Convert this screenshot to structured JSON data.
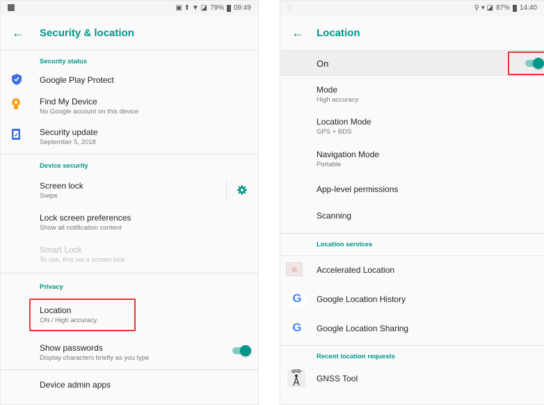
{
  "left": {
    "status": {
      "battery": "79%",
      "time": "09:49"
    },
    "title": "Security & location",
    "sections": {
      "security_status": "Security status",
      "device_security": "Device security",
      "privacy": "Privacy"
    },
    "items": {
      "play_protect": {
        "title": "Google Play Protect"
      },
      "find_device": {
        "title": "Find My Device",
        "sub": "No Google account on this device"
      },
      "security_update": {
        "title": "Security update",
        "sub": "September 5, 2018"
      },
      "screen_lock": {
        "title": "Screen lock",
        "sub": "Swipe"
      },
      "lock_prefs": {
        "title": "Lock screen preferences",
        "sub": "Show all notification content"
      },
      "smart_lock": {
        "title": "Smart Lock",
        "sub": "To use, first set a screen lock"
      },
      "location": {
        "title": "Location",
        "sub": "ON / High accuracy"
      },
      "show_passwords": {
        "title": "Show passwords",
        "sub": "Display characters briefly as you type",
        "enabled": true
      },
      "device_admin": {
        "title": "Device admin apps"
      }
    }
  },
  "right": {
    "status": {
      "battery": "87%",
      "time": "14:40"
    },
    "title": "Location",
    "master": {
      "label": "On",
      "enabled": true
    },
    "items": {
      "mode": {
        "title": "Mode",
        "sub": "High accuracy"
      },
      "location_mode": {
        "title": "Location Mode",
        "sub": "GPS + BDS"
      },
      "navigation_mode": {
        "title": "Navigation Mode",
        "sub": "Portable"
      },
      "app_permissions": {
        "title": "App-level permissions"
      },
      "scanning": {
        "title": "Scanning"
      }
    },
    "sections": {
      "location_services": "Location services",
      "recent_requests": "Recent location requests"
    },
    "services": [
      {
        "title": "Accelerated Location"
      },
      {
        "title": "Google Location History"
      },
      {
        "title": "Google Location Sharing"
      }
    ],
    "recent": [
      {
        "title": "GNSS Tool"
      }
    ],
    "icons": {
      "google_letter": "G"
    }
  },
  "colors": {
    "accent": "#009688",
    "highlight": "#e53935"
  }
}
